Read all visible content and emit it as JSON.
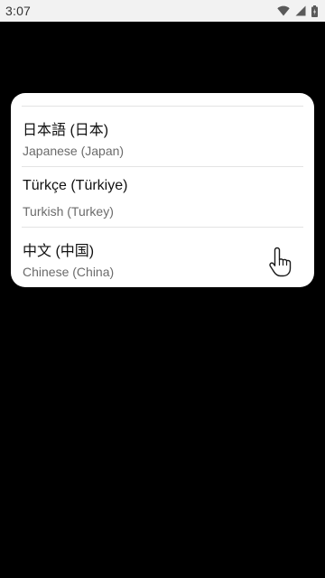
{
  "status_bar": {
    "time": "3:07",
    "icons": [
      "wifi-icon",
      "cell-signal-icon",
      "battery-icon"
    ]
  },
  "language_list": {
    "items": [
      {
        "native": "日本語 (日本)",
        "english": "Japanese (Japan)"
      },
      {
        "native": "Türkçe (Türkiye)",
        "english": "Turkish (Turkey)"
      },
      {
        "native": "中文 (中国)",
        "english": "Chinese (China)"
      }
    ]
  },
  "colors": {
    "background": "#000000",
    "card": "#ffffff",
    "status_bar": "#f2f2f2",
    "primary_text": "#111111",
    "secondary_text": "#6b6b6b",
    "divider": "#e3e3e3"
  },
  "cursor": {
    "icon": "hand-pointer-icon"
  }
}
